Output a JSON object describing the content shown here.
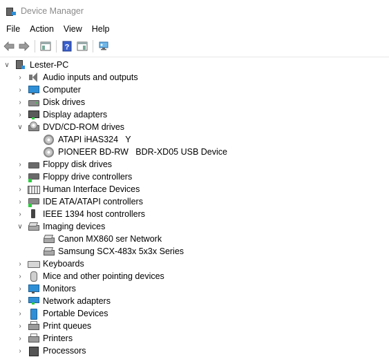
{
  "window": {
    "title": "Device Manager"
  },
  "menu": {
    "file": "File",
    "action": "Action",
    "view": "View",
    "help": "Help"
  },
  "toolbar": {
    "icons": [
      "back-arrow-icon",
      "forward-arrow-icon",
      "show-hide-console-tree-icon",
      "help-icon",
      "properties-icon",
      "scan-hardware-changes-icon"
    ]
  },
  "tree": {
    "root": "Lester-PC",
    "items": [
      {
        "label": "Audio inputs and outputs",
        "expanded": false
      },
      {
        "label": "Computer",
        "expanded": false
      },
      {
        "label": "Disk drives",
        "expanded": false
      },
      {
        "label": "Display adapters",
        "expanded": false
      },
      {
        "label": "DVD/CD-ROM drives",
        "expanded": true
      },
      {
        "label": "ATAPI iHAS324   Y",
        "child": true
      },
      {
        "label": "PIONEER BD-RW   BDR-XD05 USB Device",
        "child": true
      },
      {
        "label": "Floppy disk drives",
        "expanded": false
      },
      {
        "label": "Floppy drive controllers",
        "expanded": false
      },
      {
        "label": "Human Interface Devices",
        "expanded": false
      },
      {
        "label": "IDE ATA/ATAPI controllers",
        "expanded": false
      },
      {
        "label": "IEEE 1394 host controllers",
        "expanded": false
      },
      {
        "label": "Imaging devices",
        "expanded": true
      },
      {
        "label": "Canon MX860 ser Network",
        "child": true
      },
      {
        "label": "Samsung SCX-483x 5x3x Series",
        "child": true
      },
      {
        "label": "Keyboards",
        "expanded": false
      },
      {
        "label": "Mice and other pointing devices",
        "expanded": false
      },
      {
        "label": "Monitors",
        "expanded": false
      },
      {
        "label": "Network adapters",
        "expanded": false
      },
      {
        "label": "Portable Devices",
        "expanded": false
      },
      {
        "label": "Print queues",
        "expanded": false
      },
      {
        "label": "Printers",
        "expanded": false
      },
      {
        "label": "Processors",
        "expanded": false
      }
    ]
  },
  "colors": {
    "accent": "#2f8fd6",
    "title_text": "#8a8a8a"
  }
}
